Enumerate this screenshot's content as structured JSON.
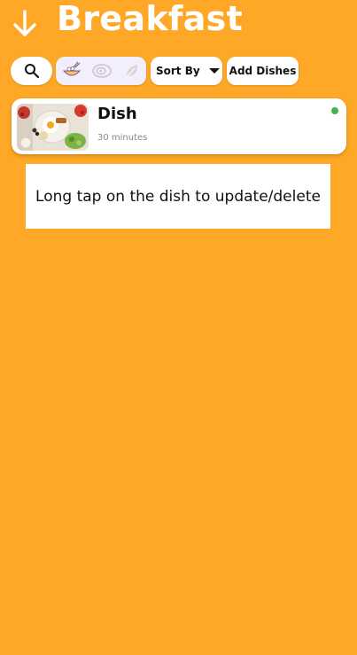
{
  "header": {
    "title": "Breakfast",
    "back_icon": "arrow-down-icon"
  },
  "toolbar": {
    "search_icon": "search-icon",
    "filters": [
      {
        "name": "all-dishes",
        "icon": "bowl-icon"
      },
      {
        "name": "non-veg",
        "icon": "meat-icon"
      },
      {
        "name": "veg",
        "icon": "leaf-icon"
      }
    ],
    "sort_label": "Sort By",
    "add_label": "Add Dishes"
  },
  "dishes": [
    {
      "name": "Dish",
      "time": "30 minutes",
      "status_color": "#4CAF50"
    }
  ],
  "hint": {
    "text": "Long tap on the dish to update/delete"
  },
  "colors": {
    "background": "#FFA726",
    "card": "#ffffff",
    "filter_bg": "#f3eefc",
    "status_green": "#4CAF50"
  }
}
